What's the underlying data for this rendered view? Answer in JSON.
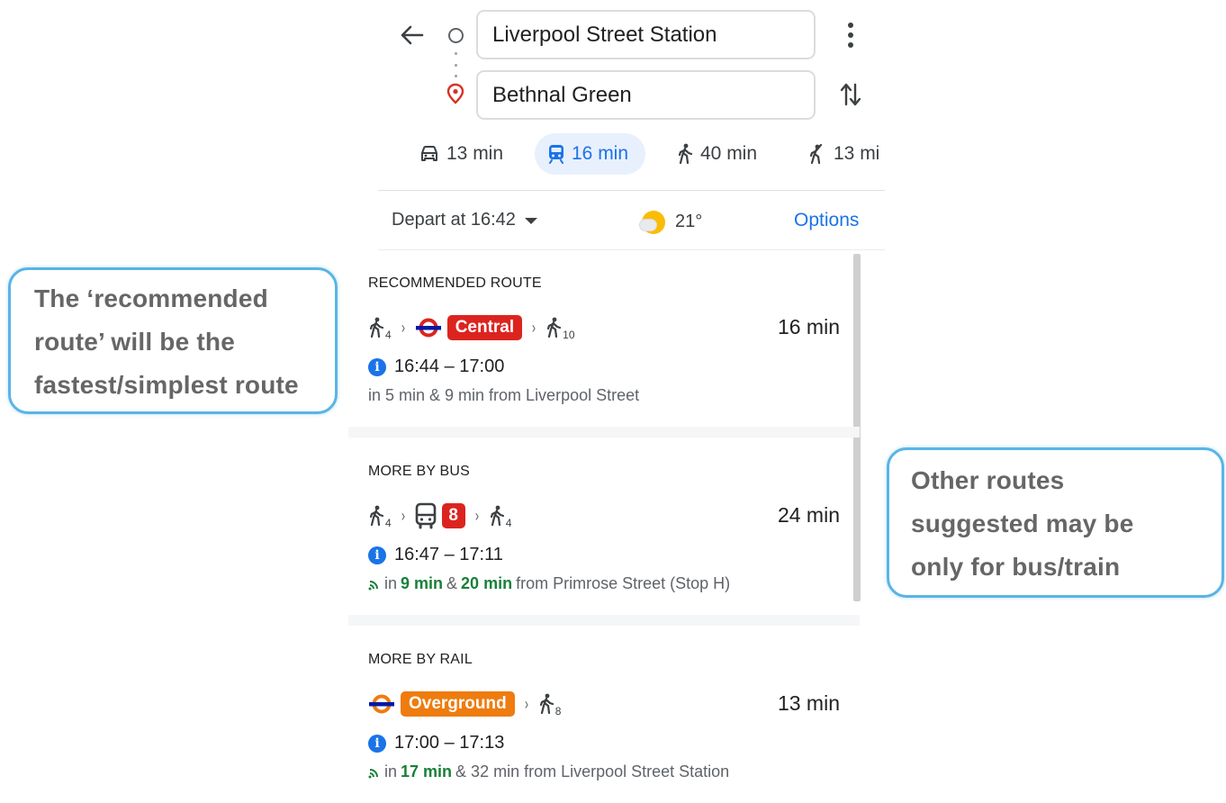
{
  "search": {
    "origin": "Liverpool Street Station",
    "destination": "Bethnal Green"
  },
  "icons": {
    "back": "back-arrow-icon",
    "origin": "origin-circle-icon",
    "destination": "location-pin-icon",
    "more": "more-vert-icon",
    "swap": "swap-icon"
  },
  "modes": [
    {
      "icon": "car-icon",
      "label": "13 min",
      "selected": false
    },
    {
      "icon": "transit-icon",
      "label": "16 min",
      "selected": true
    },
    {
      "icon": "walk-icon",
      "label": "40 min",
      "selected": false
    },
    {
      "icon": "ride-hail-icon",
      "label": "13 mi",
      "selected": false
    }
  ],
  "options_bar": {
    "depart": "Depart at 16:42",
    "temperature": "21°",
    "weather_icon": "partly-sunny-icon",
    "options_label": "Options"
  },
  "routes": [
    {
      "heading": "RECOMMENDED ROUTE",
      "walk_before": "4",
      "line_label": "Central",
      "walk_after": "10",
      "duration": "16 min",
      "times": "16:44 – 17:00",
      "detail": "in 5 min & 9 min from Liverpool Street"
    },
    {
      "heading": "MORE BY BUS",
      "walk_before": "4",
      "line_label": "8",
      "walk_after": "4",
      "duration": "24 min",
      "times": "16:47 – 17:11",
      "detail_in": "in",
      "detail_time1": "9 min",
      "detail_amp": "&",
      "detail_time2": "20 min",
      "detail_from": "from Primrose Street (Stop H)"
    },
    {
      "heading": "MORE BY RAIL",
      "line_label": "Overground",
      "walk_after": "8",
      "duration": "13 min",
      "times": "17:00 – 17:13",
      "detail_in": "in",
      "detail_time1": "17 min",
      "detail_rest": "& 32 min from Liverpool Street Station"
    }
  ],
  "colors": {
    "accent": "#1a73e8",
    "central_line": "#dc241f",
    "overground": "#ee7c0e",
    "bus": "#dc241f",
    "live_green": "#188038",
    "callout_border": "#5ab4e5"
  },
  "callouts": {
    "left": [
      "The ‘recommended",
      "route’ will be the",
      "fastest/simplest route"
    ],
    "right": [
      "Other routes",
      "suggested may be",
      "only for bus/train"
    ]
  }
}
